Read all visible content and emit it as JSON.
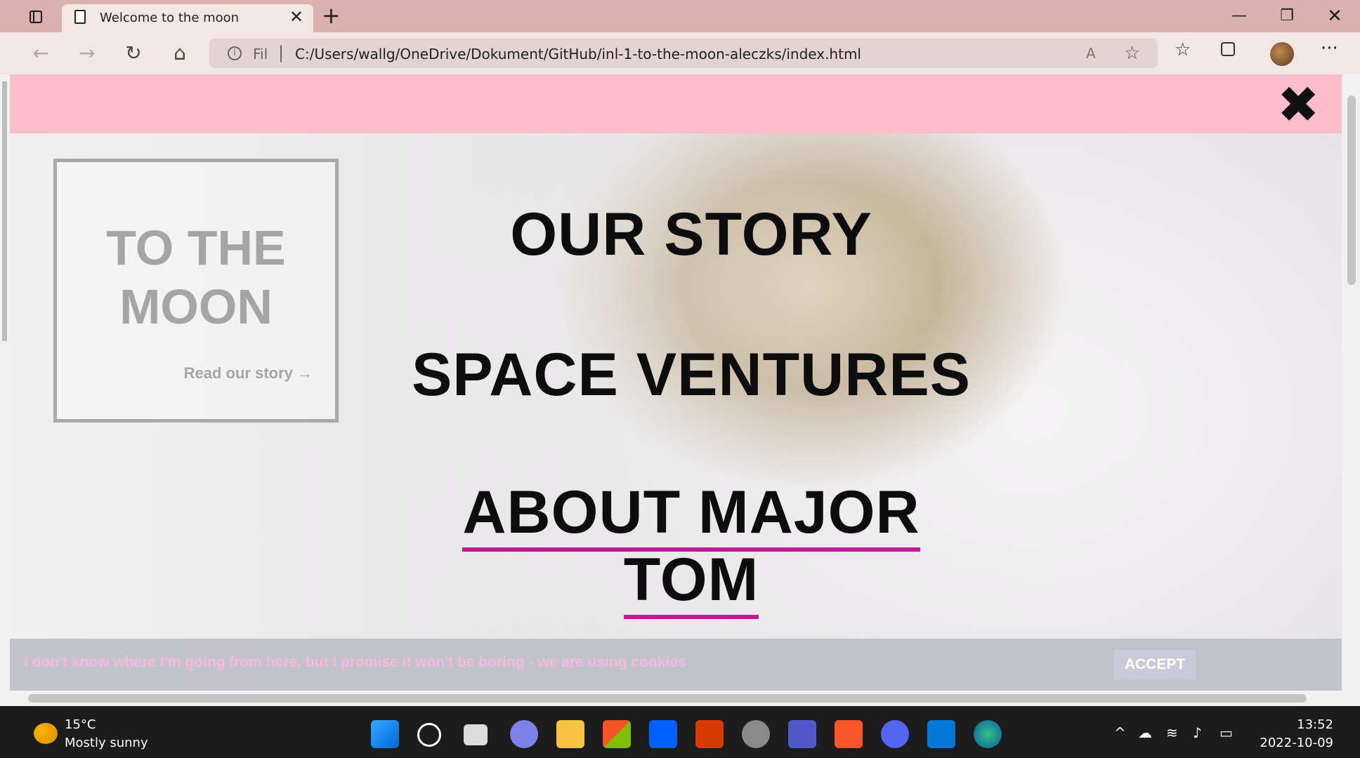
{
  "browser": {
    "tab_title": "Welcome to the moon",
    "tab_close": "✕",
    "new_tab": "+",
    "address_scheme": "Fil",
    "address_separator": "|",
    "url": "C:/Users/wallg/OneDrive/Dokument/GitHub/inl-1-to-the-moon-aleczks/index.html",
    "nav_icons": {
      "back": "←",
      "forward": "→",
      "refresh": "↻",
      "home": "⌂",
      "favorites": "☆",
      "more": "···",
      "read_aloud": "A",
      "fav_add": "☆"
    },
    "window_buttons": {
      "minimize": "—",
      "maximize": "❐",
      "close": "✕"
    }
  },
  "page": {
    "menu_close": "✖",
    "hero": {
      "title_line1": "TO THE",
      "title_line2": "MOON",
      "link": "Read our story →"
    },
    "overlay_menu": [
      "OUR STORY",
      "SPACE VENTURES",
      "ABOUT MAJOR TOM"
    ],
    "cookie_banner": {
      "text": "I don't know where I'm going from here, but I promise it won't be boring - we are using cookies",
      "accept": "ACCEPT"
    },
    "colors": {
      "menu_bar": "#fdbdcb",
      "underline_accent": "#c2189a",
      "cookie_text": "#f3b8df"
    }
  },
  "taskbar": {
    "weather_temp": "15°C",
    "weather_desc": "Mostly sunny",
    "time": "13:52",
    "date": "2022-10-09",
    "apps": [
      "windows-start-icon",
      "search-icon",
      "task-view-icon",
      "teams-chat-icon",
      "file-explorer-icon",
      "microsoft-store-icon",
      "dropbox-icon",
      "office-icon",
      "settings-icon",
      "teams-icon",
      "brave-icon",
      "discord-icon",
      "vscode-icon",
      "edge-icon"
    ]
  }
}
